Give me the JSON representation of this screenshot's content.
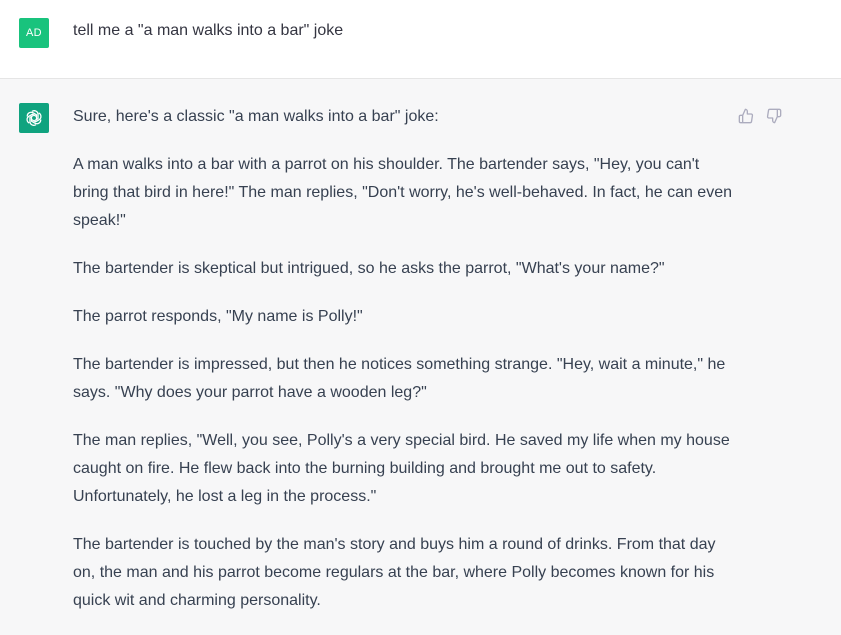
{
  "colors": {
    "user_avatar_bg": "#19c37d",
    "bot_avatar_bg": "#10a37f"
  },
  "user": {
    "avatar_initials": "AD",
    "message": "tell me a \"a man walks into a bar\" joke"
  },
  "assistant": {
    "avatar_icon": "openai-logo-icon",
    "paragraphs": [
      "Sure, here's a classic \"a man walks into a bar\" joke:",
      "A man walks into a bar with a parrot on his shoulder. The bartender says, \"Hey, you can't bring that bird in here!\" The man replies, \"Don't worry, he's well-behaved. In fact, he can even speak!\"",
      "The bartender is skeptical but intrigued, so he asks the parrot, \"What's your name?\"",
      "The parrot responds, \"My name is Polly!\"",
      "The bartender is impressed, but then he notices something strange. \"Hey, wait a minute,\" he says. \"Why does your parrot have a wooden leg?\"",
      "The man replies, \"Well, you see, Polly's a very special bird. He saved my life when my house caught on fire. He flew back into the burning building and brought me out to safety. Unfortunately, he lost a leg in the process.\"",
      "The bartender is touched by the man's story and buys him a round of drinks. From that day on, the man and his parrot become regulars at the bar, where Polly becomes known for his quick wit and charming personality."
    ],
    "feedback": {
      "up_icon": "thumbs-up-icon",
      "down_icon": "thumbs-down-icon"
    }
  }
}
